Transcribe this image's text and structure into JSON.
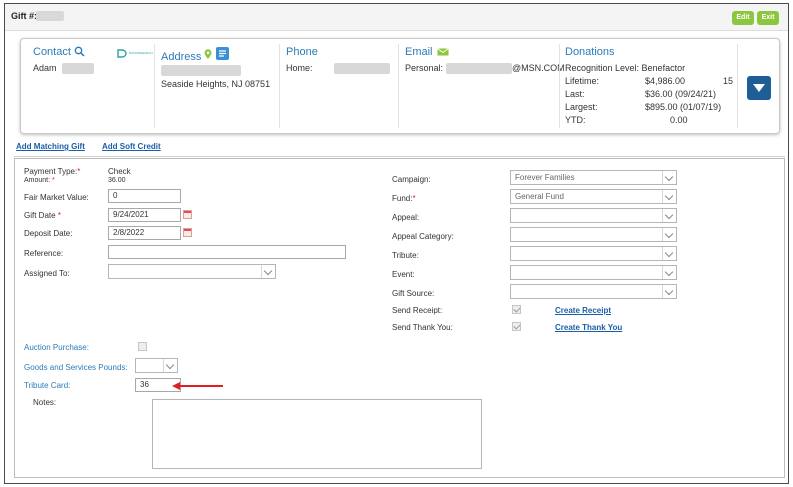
{
  "header": {
    "gift_label": "Gift #:",
    "edit_label": "Edit",
    "exit_label": "Exit"
  },
  "contact": {
    "heading": "Contact",
    "first_name": "Adam",
    "brand_text": "DONORSEARCH"
  },
  "address": {
    "heading": "Address",
    "city_line": "Seaside Heights, NJ 08751"
  },
  "phone": {
    "heading": "Phone",
    "home_label": "Home:"
  },
  "email": {
    "heading": "Email",
    "personal_label": "Personal:",
    "domain": "@MSN.COM"
  },
  "donations": {
    "heading": "Donations",
    "recognition": "Recognition Level: Benefactor",
    "lifetime_label": "Lifetime:",
    "lifetime_value": "$4,986.00",
    "lifetime_count": "15",
    "last_label": "Last:",
    "last_value": "$36.00 (09/24/21)",
    "largest_label": "Largest:",
    "largest_value": "$895.00 (01/07/19)",
    "ytd_label": "YTD:",
    "ytd_value": "0.00"
  },
  "links": {
    "add_matching_gift": "Add Matching Gift",
    "add_soft_credit": "Add Soft Credit",
    "create_receipt": "Create Receipt",
    "create_thank_you": "Create Thank You"
  },
  "form_left": {
    "payment_type_label": "Payment Type:",
    "payment_type_value": "Check",
    "amount_label": "Amount:",
    "amount_value": "36.00",
    "fair_market_label": "Fair Market Value:",
    "fair_market_value": "0",
    "gift_date_label": "Gift Date",
    "gift_date_value": "9/24/2021",
    "deposit_date_label": "Deposit Date:",
    "deposit_date_value": "2/8/2022",
    "reference_label": "Reference:",
    "reference_value": "",
    "assigned_to_label": "Assigned To:",
    "assigned_to_value": ""
  },
  "form_right": {
    "campaign_label": "Campaign:",
    "campaign_value": "Forever Families",
    "fund_label": "Fund:",
    "fund_value": "General Fund",
    "appeal_label": "Appeal:",
    "appeal_value": "",
    "appeal_category_label": "Appeal Category:",
    "appeal_category_value": "",
    "tribute_label": "Tribute:",
    "tribute_value": "",
    "event_label": "Event:",
    "event_value": "",
    "gift_source_label": "Gift Source:",
    "gift_source_value": "",
    "send_receipt_label": "Send Receipt:",
    "send_thank_you_label": "Send Thank You:"
  },
  "form_bottom": {
    "auction_label": "Auction Purchase:",
    "goods_label": "Goods and Services Pounds:",
    "tribute_card_label": "Tribute Card:",
    "tribute_card_value": "36",
    "notes_label": "Notes:"
  },
  "colors": {
    "accent_blue": "#2b7bb9",
    "button_green": "#8cc63f",
    "dropdown_navy": "#1d5e96",
    "required_red": "#e02020"
  }
}
